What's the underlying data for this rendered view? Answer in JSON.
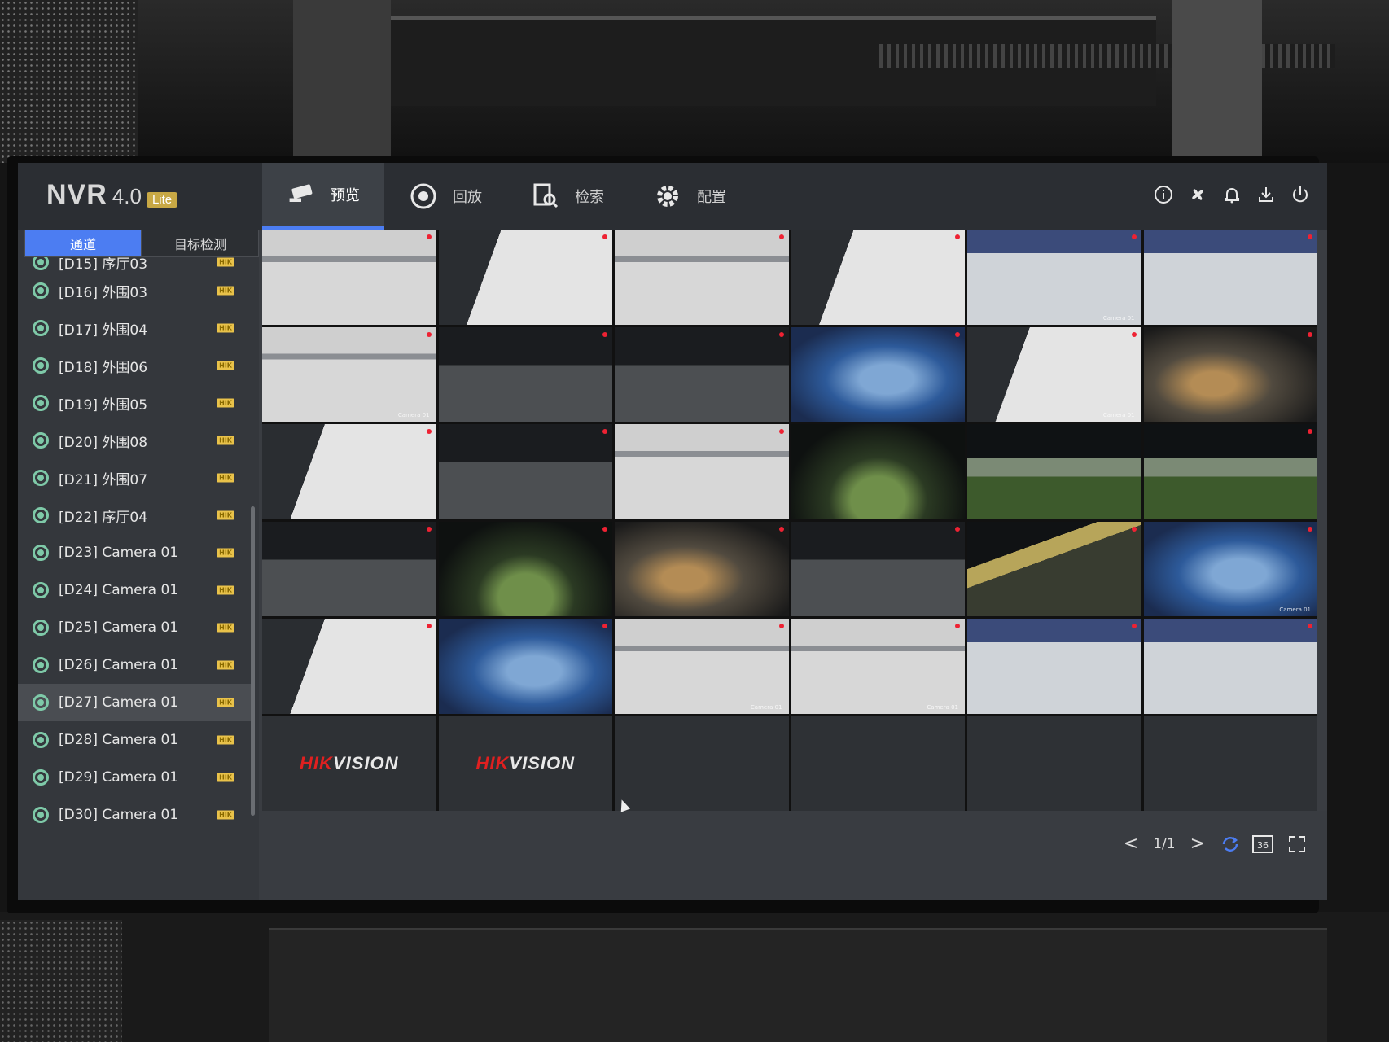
{
  "app": {
    "name": "NVR",
    "version": "4.0",
    "edition": "Lite"
  },
  "nav": [
    {
      "label": "预览",
      "icon": "camera-icon",
      "active": true
    },
    {
      "label": "回放",
      "icon": "playback-icon",
      "active": false
    },
    {
      "label": "检索",
      "icon": "search-file-icon",
      "active": false
    },
    {
      "label": "配置",
      "icon": "gear-icon",
      "active": false
    }
  ],
  "top_actions": [
    "info-icon",
    "fan-icon",
    "bell-icon",
    "download-icon",
    "power-icon"
  ],
  "left_tabs": [
    {
      "label": "通道",
      "active": true
    },
    {
      "label": "目标检测",
      "active": false
    }
  ],
  "channels": [
    {
      "label": "[D15] 序厅03",
      "badge": "HIK"
    },
    {
      "label": "[D16] 外围03",
      "badge": "HIK"
    },
    {
      "label": "[D17] 外围04",
      "badge": "HIK"
    },
    {
      "label": "[D18] 外围06",
      "badge": "HIK"
    },
    {
      "label": "[D19] 外围05",
      "badge": "HIK"
    },
    {
      "label": "[D20] 外围08",
      "badge": "HIK"
    },
    {
      "label": "[D21] 外围07",
      "badge": "HIK"
    },
    {
      "label": "[D22] 序厅04",
      "badge": "HIK"
    },
    {
      "label": "[D23] Camera 01",
      "badge": "HIK"
    },
    {
      "label": "[D24] Camera 01",
      "badge": "HIK"
    },
    {
      "label": "[D25] Camera 01",
      "badge": "HIK"
    },
    {
      "label": "[D26] Camera 01",
      "badge": "HIK"
    },
    {
      "label": "[D27] Camera 01",
      "badge": "HIK",
      "selected": true
    },
    {
      "label": "[D28] Camera 01",
      "badge": "HIK"
    },
    {
      "label": "[D29] Camera 01",
      "badge": "HIK"
    },
    {
      "label": "[D30] Camera 01",
      "badge": "HIK"
    }
  ],
  "tile_label": "Camera 01",
  "brand": {
    "part1": "HIK",
    "part2": "VISION"
  },
  "pager": {
    "text": "1/1",
    "prev": "<",
    "next": ">"
  },
  "layout_badge": "36",
  "colors": {
    "accent": "#4c7df2",
    "hik_badge": "#e9c24a",
    "brand_red": "#e02020"
  }
}
